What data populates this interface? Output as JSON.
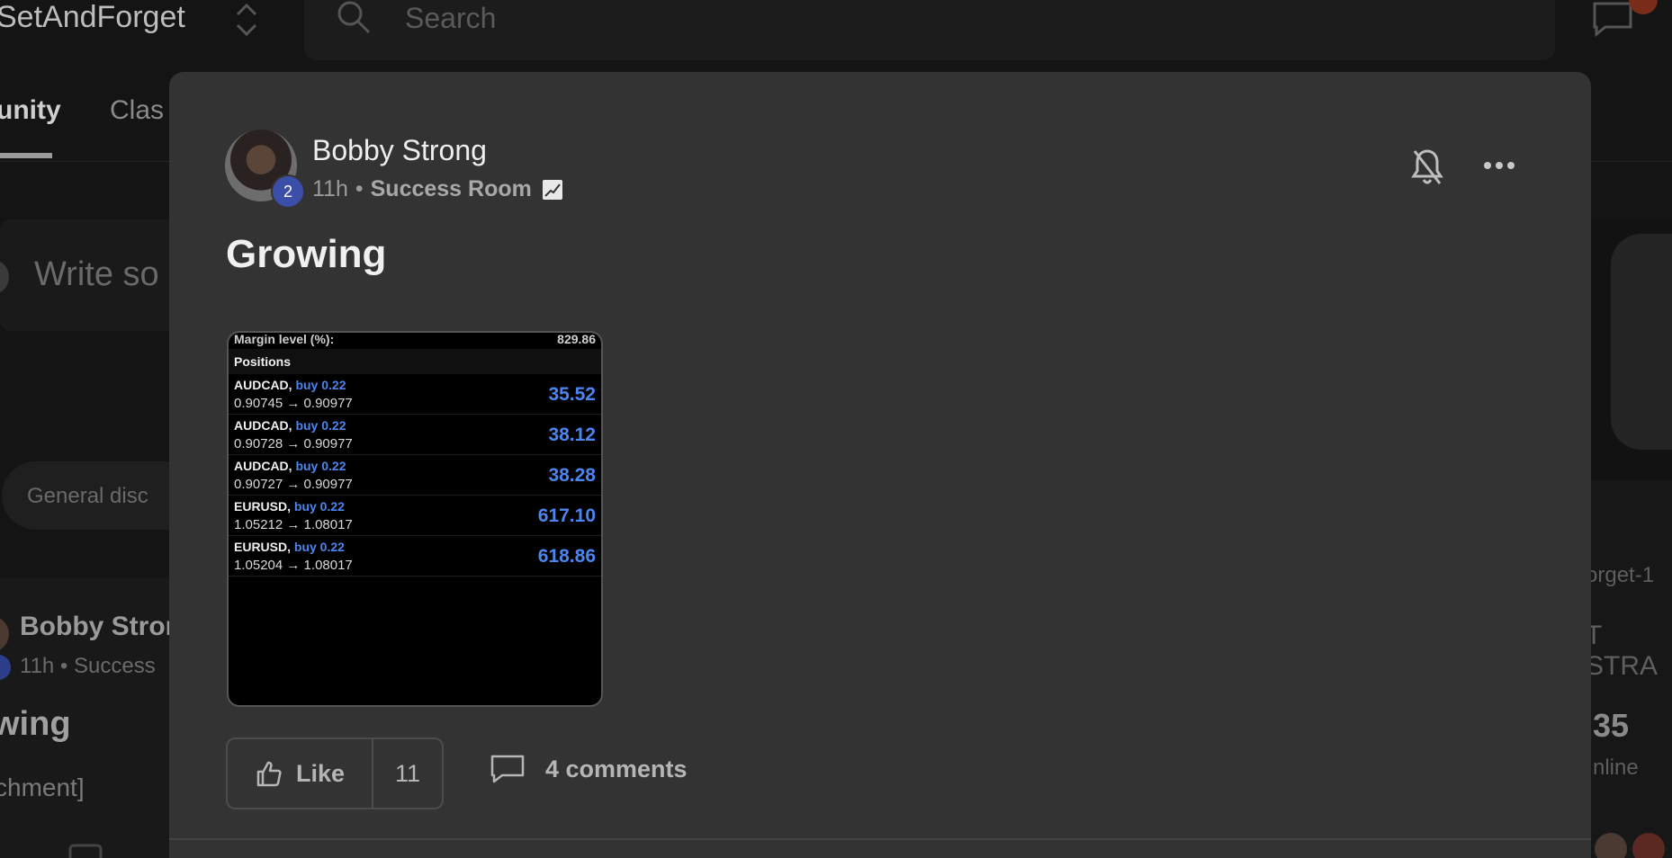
{
  "background": {
    "brand": "SetAndForget",
    "search_placeholder": "Search",
    "tabs": [
      "unity",
      "Clas"
    ],
    "compose_placeholder": "Write so",
    "chip": "General disc",
    "feed": {
      "author": "Bobby Stron",
      "meta": "11h • Success",
      "title": "wing",
      "attachment": "chment]"
    },
    "right": {
      "line1": ":",
      "line2": "orget-1",
      "line3": "T STRA",
      "count": "35",
      "count_label": "nline"
    }
  },
  "post": {
    "author": "Bobby Strong",
    "level": "2",
    "time": "11h",
    "separator": "•",
    "room": "Success Room",
    "room_emoji_icon": "chart-increasing-icon",
    "title": "Growing",
    "like_label": "Like",
    "like_count": "11",
    "comments_label": "4 comments"
  },
  "attachment": {
    "margin_label": "Margin level (%):",
    "margin_value": "829.86",
    "section": "Positions",
    "positions": [
      {
        "pair": "AUDCAD,",
        "dir": "buy 0.22",
        "prices": "0.90745 → 0.90977",
        "profit": "35.52"
      },
      {
        "pair": "AUDCAD,",
        "dir": "buy 0.22",
        "prices": "0.90728 → 0.90977",
        "profit": "38.12"
      },
      {
        "pair": "AUDCAD,",
        "dir": "buy 0.22",
        "prices": "0.90727 → 0.90977",
        "profit": "38.28"
      },
      {
        "pair": "EURUSD,",
        "dir": "buy 0.22",
        "prices": "1.05212 → 1.08017",
        "profit": "617.10"
      },
      {
        "pair": "EURUSD,",
        "dir": "buy 0.22",
        "prices": "1.05204 → 1.08017",
        "profit": "618.86"
      }
    ]
  },
  "colors": {
    "modal_bg": "#333333",
    "level_badge": "#3c4fa8",
    "profit_blue": "#4b86f0"
  }
}
